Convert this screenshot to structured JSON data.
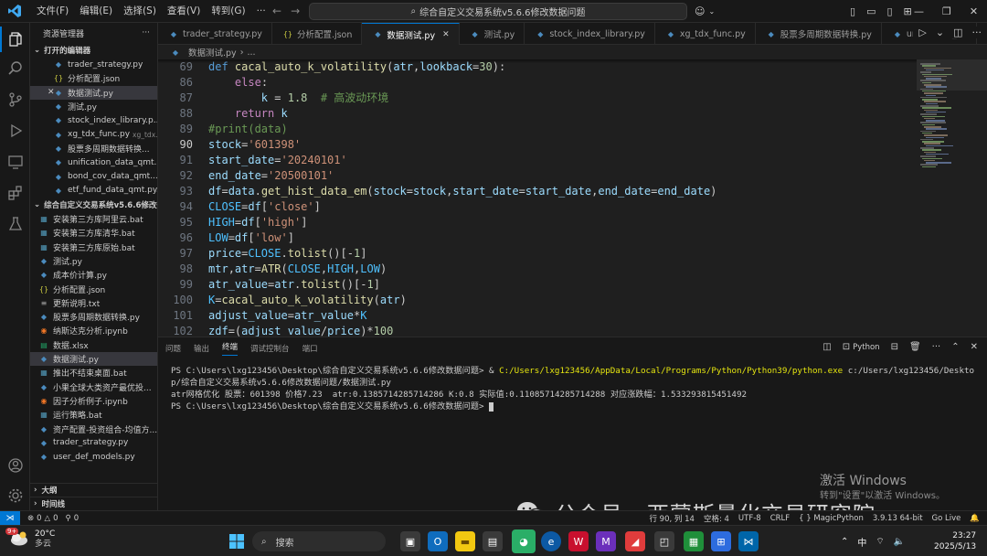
{
  "titlebar": {
    "menus": [
      "文件(F)",
      "编辑(E)",
      "选择(S)",
      "查看(V)",
      "转到(G)",
      "···"
    ],
    "command_center": "综合自定义交易系统v5.6.6修改数据问题"
  },
  "sidebar": {
    "header": "资源管理器",
    "open_editors_title": "打开的编辑器",
    "open_editors": [
      {
        "name": "trader_strategy.py",
        "type": "py",
        "desc": ""
      },
      {
        "name": "分析配置.json",
        "type": "json",
        "desc": ""
      },
      {
        "name": "数据测试.py",
        "type": "py",
        "desc": ""
      },
      {
        "name": "测试.py",
        "type": "py",
        "desc": ""
      },
      {
        "name": "stock_index_library.p...",
        "type": "py",
        "desc": ""
      },
      {
        "name": "xg_tdx_func.py",
        "type": "py",
        "desc": "xg_tdx..."
      },
      {
        "name": "股票多周期数据转换...",
        "type": "py",
        "desc": ""
      },
      {
        "name": "unification_data_qmt....",
        "type": "py",
        "desc": ""
      },
      {
        "name": "bond_cov_data_qmt....",
        "type": "py",
        "desc": ""
      },
      {
        "name": "etf_fund_data_qmt.py...",
        "type": "py",
        "desc": ""
      }
    ],
    "folder_title": "综合自定义交易系统v5.6.6修改数...",
    "files": [
      {
        "name": "安装第三方库阿里云.bat",
        "type": "bat"
      },
      {
        "name": "安装第三方库清华.bat",
        "type": "bat"
      },
      {
        "name": "安装第三方库原始.bat",
        "type": "bat"
      },
      {
        "name": "测试.py",
        "type": "py"
      },
      {
        "name": "成本价计算.py",
        "type": "py"
      },
      {
        "name": "分析配置.json",
        "type": "json"
      },
      {
        "name": "更新说明.txt",
        "type": "txt"
      },
      {
        "name": "股票多周期数据转换.py",
        "type": "py"
      },
      {
        "name": "纳斯达克分析.ipynb",
        "type": "ipynb"
      },
      {
        "name": "数据.xlsx",
        "type": "xlsx"
      },
      {
        "name": "数据测试.py",
        "type": "py"
      },
      {
        "name": "推出不结束桌面.bat",
        "type": "bat"
      },
      {
        "name": "小果全球大类资产最优投...",
        "type": "py"
      },
      {
        "name": "因子分析例子.ipynb",
        "type": "ipynb"
      },
      {
        "name": "运行策略.bat",
        "type": "bat"
      },
      {
        "name": "资产配置-投资组合-均值方...",
        "type": "py"
      },
      {
        "name": "trader_strategy.py",
        "type": "py"
      },
      {
        "name": "user_def_models.py",
        "type": "py"
      }
    ],
    "outline_title": "大纲",
    "timeline_title": "时间线"
  },
  "tabs": [
    {
      "label": "trader_strategy.py",
      "type": "py",
      "active": false
    },
    {
      "label": "分析配置.json",
      "type": "json",
      "active": false
    },
    {
      "label": "数据测试.py",
      "type": "py",
      "active": true
    },
    {
      "label": "测试.py",
      "type": "py",
      "active": false
    },
    {
      "label": "stock_index_library.py",
      "type": "py",
      "active": false
    },
    {
      "label": "xg_tdx_func.py",
      "type": "py",
      "active": false
    },
    {
      "label": "股票多周期数据转换.py",
      "type": "py",
      "active": false
    },
    {
      "label": "unification_da",
      "type": "py",
      "active": false
    }
  ],
  "breadcrumb": {
    "file": "数据测试.py",
    "rest": "..."
  },
  "editor": {
    "line_numbers": [
      "69",
      "86",
      "87",
      "88",
      "89",
      "90",
      "91",
      "92",
      "93",
      "94",
      "95",
      "96",
      "97",
      "98",
      "99",
      "100",
      "101",
      "102"
    ],
    "current_line": "90"
  },
  "panel": {
    "tabs": [
      "问题",
      "输出",
      "终端",
      "调试控制台",
      "端口"
    ],
    "active_tab": "终端",
    "shell_label": "Python",
    "terminal": {
      "prompt1": "PS C:\\Users\\lxg123456\\Desktop\\综合自定义交易系统v5.6.6修改数据问题> & ",
      "cmd1": "C:/Users/lxg123456/AppData/Local/Programs/Python/Python39/python.exe",
      "arg1": " c:/Users/lxg123456/Desktop/综合自定义交易系统v5.6.6修改数据问题/数据测试.py",
      "output1": "atr网格优化 股票：601398 价格7.23  atr:0.1385714285714286 K:0.8 实际值:0.11085714285714288 对应涨跌幅：1.533293815451492",
      "prompt2": "PS C:\\Users\\lxg123456\\Desktop\\综合自定义交易系统v5.6.6修改数据问题> "
    }
  },
  "statusbar": {
    "errors": "0",
    "warnings": "0",
    "infos": "0",
    "right_items": [
      "行 90, 列 14",
      "空格: 4",
      "UTF-8",
      "CRLF",
      "{ } MagicPython",
      "3.9.13 64-bit",
      "Go Live"
    ]
  },
  "watermark": {
    "activate_title": "激活 Windows",
    "activate_sub": "转到\"设置\"以激活 Windows。",
    "brand": "公众号 · 西蒙斯量化交易研究院"
  },
  "taskbar": {
    "weather_temp": "20°C",
    "weather_desc": "多云",
    "weather_badge": "9+",
    "search_placeholder": "搜索",
    "ime": "中",
    "time": "23:27",
    "date": "2025/5/13"
  }
}
